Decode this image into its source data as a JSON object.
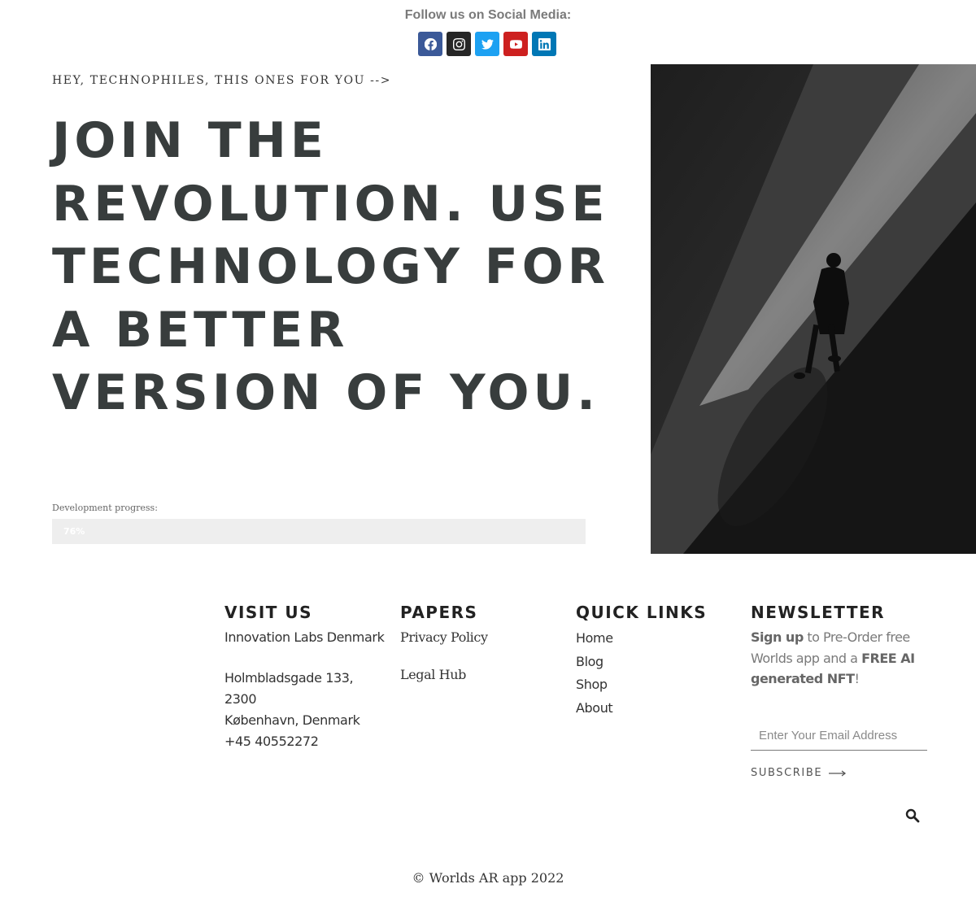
{
  "social": {
    "title": "Follow us on Social Media:",
    "buttons": [
      {
        "icon": "facebook-icon",
        "color": "#3b5998"
      },
      {
        "icon": "instagram-icon",
        "color": "#262626"
      },
      {
        "icon": "twitter-icon",
        "color": "#1da1f2"
      },
      {
        "icon": "youtube-icon",
        "color": "#cd201f"
      },
      {
        "icon": "linkedin-icon",
        "color": "#0077b5"
      }
    ]
  },
  "hero": {
    "eyebrow": "HEY, TECHNOPHILES, THIS ONES FOR YOU -->",
    "headline": "JOIN THE REVOLUTION. USE TECHNOLOGY FOR A BETTER VERSION OF YOU.",
    "progress": {
      "label": "Development progress:",
      "value_text": "76%",
      "value": 76
    }
  },
  "footer": {
    "visit": {
      "title": "VISIT US",
      "name": "Innovation Labs Denmark",
      "address_line1": "Holmbladsgade 133, 2300",
      "address_line2": "København, Denmark",
      "phone": "+45 40552272"
    },
    "papers": {
      "title": "PAPERS",
      "links": [
        "Privacy Policy",
        "Legal Hub"
      ]
    },
    "quick_links": {
      "title": "QUICK LINKS",
      "links": [
        "Home",
        "Blog",
        "Shop",
        "About"
      ]
    },
    "newsletter": {
      "title": "NEWSLETTER",
      "text_strong1": "Sign up",
      "text_mid": " to Pre-Order free Worlds app and a ",
      "text_strong2": "FREE AI generated NFT",
      "text_end": "!",
      "email_placeholder": "Enter Your Email Address",
      "subscribe_label": "SUBSCRIBE"
    }
  },
  "copyright": "© Worlds AR app 2022"
}
